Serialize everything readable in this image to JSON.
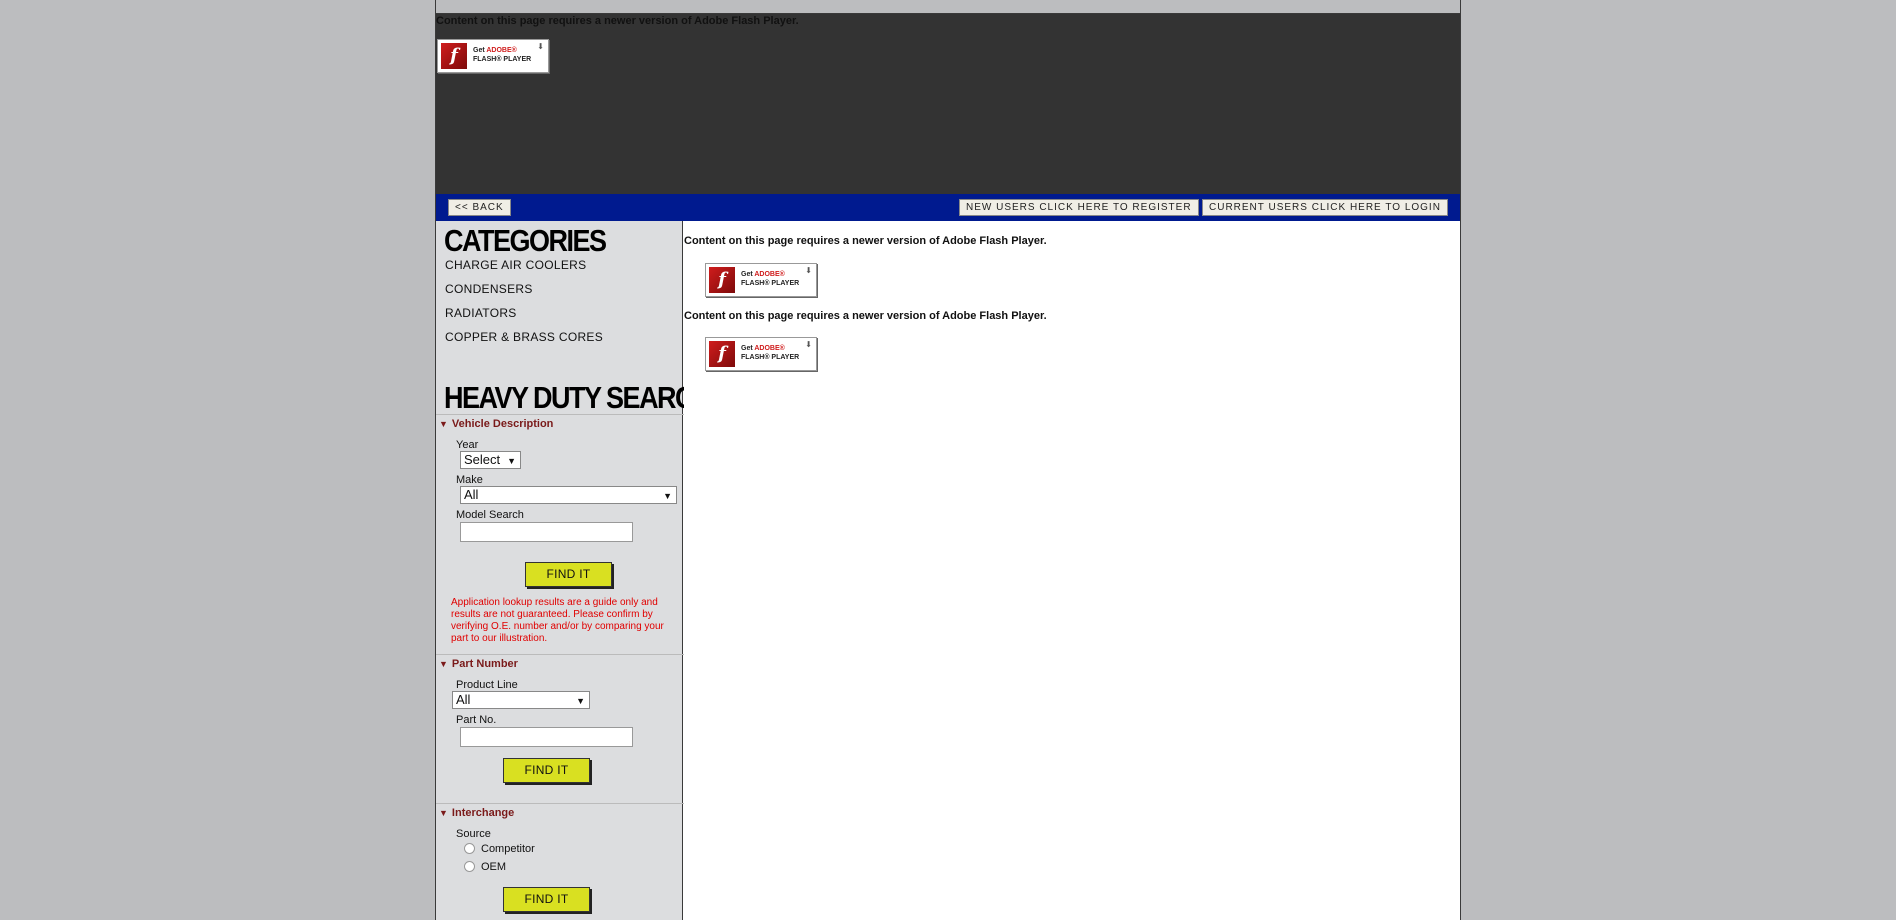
{
  "header": {
    "flash_message": "Content on this page requires a newer version of Adobe Flash Player.",
    "flash_badge": {
      "get": "Get",
      "adobe": "ADOBE®",
      "player": "FLASH® PLAYER"
    }
  },
  "nav": {
    "back_label": "<< BACK",
    "register_label": "NEW USERS CLICK HERE TO REGISTER",
    "login_label": "CURRENT USERS CLICK HERE TO LOGIN"
  },
  "sidebar": {
    "categories_heading": "CATEGORIES",
    "categories": [
      "CHARGE AIR COOLERS",
      "CONDENSERS",
      "RADIATORS",
      "COPPER & BRASS CORES"
    ],
    "search_heading": "HEAVY DUTY SEARCH",
    "vehicle": {
      "title": "Vehicle Description",
      "year_label": "Year",
      "year_value": "Select",
      "make_label": "Make",
      "make_value": "All",
      "model_label": "Model Search",
      "find_label": "FIND IT",
      "disclaimer": "Application lookup results are a guide only and results are not guaranteed. Please confirm by verifying O.E. number and/or by comparing your part to our illustration."
    },
    "part": {
      "title": "Part Number",
      "product_line_label": "Product Line",
      "product_line_value": "All",
      "part_no_label": "Part No.",
      "find_label": "FIND IT"
    },
    "interchange": {
      "title": "Interchange",
      "source_label": "Source",
      "options": [
        "Competitor",
        "OEM"
      ],
      "find_label": "FIND IT"
    }
  },
  "content": {
    "flash_messages": [
      "Content on this page requires a newer version of Adobe Flash Player.",
      "Content on this page requires a newer version of Adobe Flash Player."
    ]
  },
  "colors": {
    "navbar": "#001a8f",
    "header_bg": "#333333",
    "find_button": "#d9e021",
    "section_title": "#7a1a1a",
    "disclaimer": "#e00000"
  }
}
